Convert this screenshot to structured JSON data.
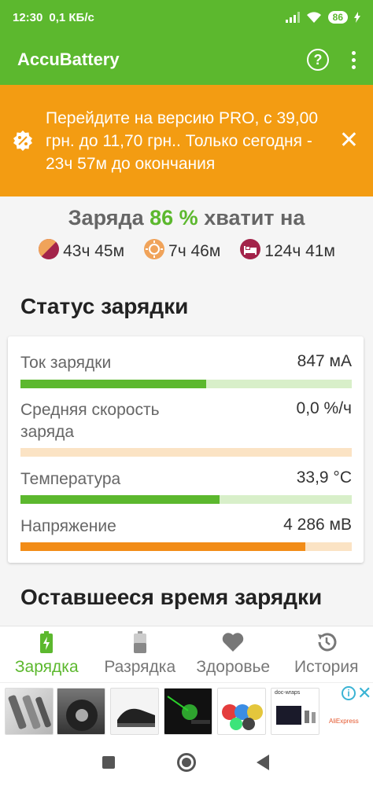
{
  "status_bar": {
    "time": "12:30",
    "speed": "0,1 КБ/с",
    "battery": "86"
  },
  "app_bar": {
    "title": "AccuBattery",
    "help_icon": "help-circle-icon",
    "menu_icon": "more-vert-icon"
  },
  "promo": {
    "icon": "discount-tag-icon",
    "text": "Перейдите на версию PRO, с 39,00 грн. до 11,70 грн.. Только сегодня - 23ч 57м до окончания",
    "close_icon": "close-icon",
    "color": "#f39c12"
  },
  "summary": {
    "prefix": "Заряда",
    "percent": "86 %",
    "suffix": "хватит на",
    "times": [
      {
        "icon": "screen-on-icon",
        "value": "43ч 45м"
      },
      {
        "icon": "screen-off-icon",
        "value": "7ч 46м"
      },
      {
        "icon": "sleep-bed-icon",
        "value": "124ч 41м"
      }
    ]
  },
  "charging_status": {
    "title": "Статус зарядки",
    "rows": [
      {
        "label": "Ток зарядки",
        "value": "847 мА",
        "level": 0.56,
        "fill_color": "#5cb82e",
        "track_color": "#d8efc9"
      },
      {
        "label": "Средняя скорость заряда",
        "value": "0,0 %/ч",
        "level": 0.0,
        "fill_color": "#f39c12",
        "track_color": "#fbe3c4"
      },
      {
        "label": "Температура",
        "value": "33,9 °C",
        "level": 0.6,
        "fill_color": "#5cb82e",
        "track_color": "#d8efc9"
      },
      {
        "label": "Напряжение",
        "value": "4 286 мВ",
        "level": 0.86,
        "fill_color": "#f28c17",
        "track_color": "#fbe3c4"
      }
    ]
  },
  "remaining_section": {
    "title": "Оставшееся время зарядки"
  },
  "bottom_nav": {
    "items": [
      {
        "label": "Зарядка",
        "icon": "battery-charging-icon",
        "active": true
      },
      {
        "label": "Разрядка",
        "icon": "battery-icon",
        "active": false
      },
      {
        "label": "Здоровье",
        "icon": "heart-icon",
        "active": false
      },
      {
        "label": "История",
        "icon": "history-icon",
        "active": false
      }
    ]
  },
  "ad": {
    "brand": "AliExpress",
    "products_label": "doc-wraps"
  },
  "colors": {
    "accent": "#5cb82e",
    "promo": "#f39c12"
  }
}
